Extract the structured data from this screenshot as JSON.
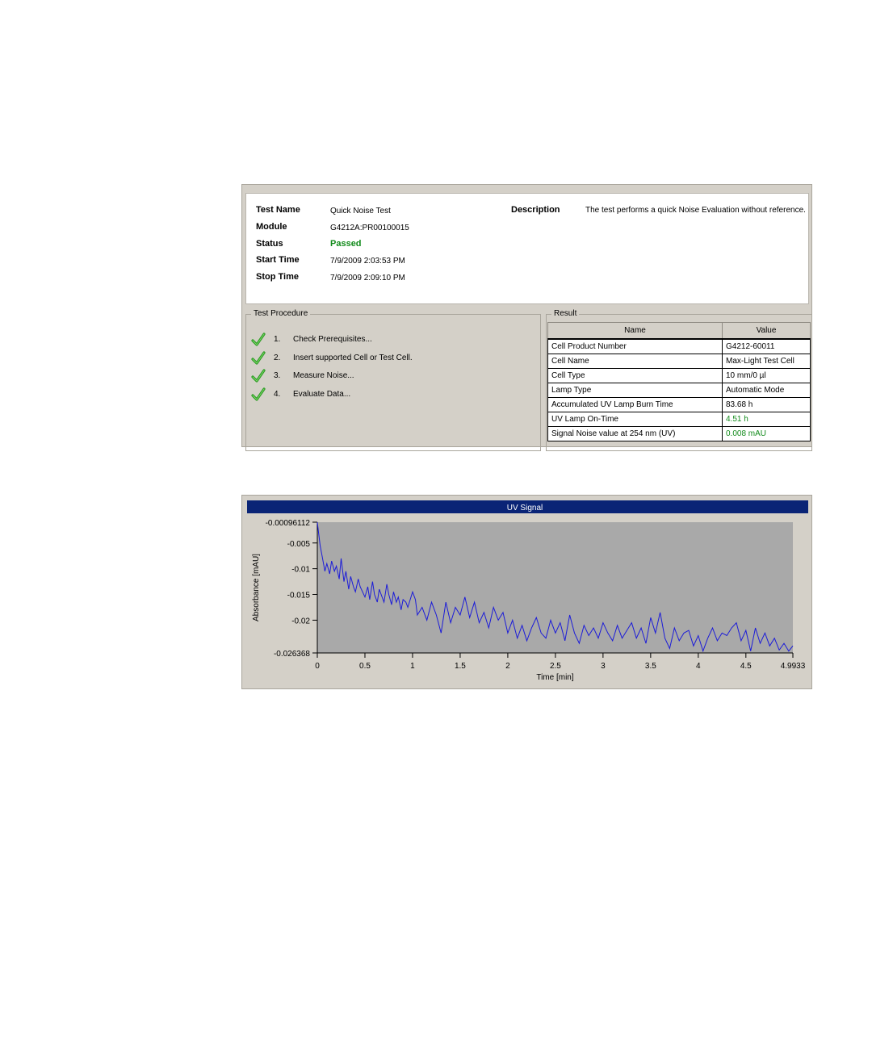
{
  "header": {
    "labels": {
      "test_name": "Test Name",
      "module": "Module",
      "status": "Status",
      "start_time": "Start Time",
      "stop_time": "Stop Time",
      "description": "Description"
    },
    "test_name": "Quick Noise Test",
    "module": "G4212A:PR00100015",
    "status": "Passed",
    "start_time": "7/9/2009 2:03:53 PM",
    "stop_time": "7/9/2009 2:09:10 PM",
    "description": "The test performs a quick Noise Evaluation without reference."
  },
  "procedure": {
    "title": "Test Procedure",
    "steps": [
      {
        "num": "1.",
        "label": "Check Prerequisites...",
        "icon": "check-icon"
      },
      {
        "num": "2.",
        "label": "Insert supported Cell or Test Cell.",
        "icon": "check-icon"
      },
      {
        "num": "3.",
        "label": "Measure Noise...",
        "icon": "check-icon"
      },
      {
        "num": "4.",
        "label": "Evaluate Data...",
        "icon": "check-icon"
      }
    ]
  },
  "result": {
    "title": "Result",
    "columns": [
      "Name",
      "Value"
    ],
    "rows": [
      {
        "name": "Cell Product Number",
        "value": "G4212-60011"
      },
      {
        "name": "Cell Name",
        "value": "Max-Light Test Cell"
      },
      {
        "name": "Cell Type",
        "value": "10 mm/0 µl"
      },
      {
        "name": "Lamp Type",
        "value": "Automatic Mode"
      },
      {
        "name": "Accumulated UV Lamp Burn Time",
        "value": "83.68 h"
      },
      {
        "name": "UV Lamp On-Time",
        "value": "4.51 h"
      },
      {
        "name": "Signal Noise value at 254 nm (UV)",
        "value": "0.008 mAU"
      }
    ]
  },
  "colors": {
    "status_passed": "#118a1a",
    "chart_title_bar": "#0a2476",
    "plot_area": "#a9a9a9",
    "trace": "#1c1cd8"
  },
  "chart_data": {
    "type": "line",
    "title": "UV Signal",
    "xlabel": "Time [min]",
    "ylabel": "Absorbance [mAU]",
    "xlim": [
      0,
      4.9933
    ],
    "ylim": [
      -0.026368,
      -0.00096112
    ],
    "xticks": [
      0,
      0.5,
      1,
      1.5,
      2,
      2.5,
      3,
      3.5,
      4,
      4.5,
      4.9933
    ],
    "xtick_labels": [
      "0",
      "0.5",
      "1",
      "1.5",
      "2",
      "2.5",
      "3",
      "3.5",
      "4",
      "4.5",
      "4.9933"
    ],
    "yticks": [
      -0.00096112,
      -0.005,
      -0.01,
      -0.015,
      -0.02,
      -0.026368
    ],
    "ytick_labels": [
      "-0.00096112",
      "-0.005",
      "-0.01",
      "-0.015",
      "-0.02",
      "-0.026368"
    ],
    "grid": false,
    "x": [
      0,
      0.03,
      0.05,
      0.08,
      0.1,
      0.13,
      0.15,
      0.18,
      0.2,
      0.23,
      0.25,
      0.28,
      0.3,
      0.33,
      0.35,
      0.38,
      0.4,
      0.43,
      0.45,
      0.5,
      0.53,
      0.55,
      0.58,
      0.6,
      0.63,
      0.65,
      0.68,
      0.7,
      0.73,
      0.75,
      0.78,
      0.8,
      0.83,
      0.85,
      0.88,
      0.9,
      0.93,
      0.95,
      1.0,
      1.03,
      1.05,
      1.1,
      1.15,
      1.2,
      1.25,
      1.3,
      1.35,
      1.4,
      1.45,
      1.5,
      1.55,
      1.6,
      1.65,
      1.7,
      1.75,
      1.8,
      1.85,
      1.9,
      1.95,
      2.0,
      2.05,
      2.1,
      2.15,
      2.2,
      2.25,
      2.3,
      2.35,
      2.4,
      2.45,
      2.5,
      2.55,
      2.6,
      2.65,
      2.7,
      2.75,
      2.8,
      2.85,
      2.9,
      2.95,
      3.0,
      3.05,
      3.1,
      3.15,
      3.2,
      3.25,
      3.3,
      3.35,
      3.4,
      3.45,
      3.5,
      3.55,
      3.6,
      3.65,
      3.7,
      3.75,
      3.8,
      3.85,
      3.9,
      3.95,
      4.0,
      4.05,
      4.1,
      4.15,
      4.2,
      4.25,
      4.3,
      4.35,
      4.4,
      4.45,
      4.5,
      4.55,
      4.6,
      4.65,
      4.7,
      4.75,
      4.8,
      4.85,
      4.9,
      4.95,
      4.9933
    ],
    "values": [
      -0.001,
      -0.0055,
      -0.0075,
      -0.0105,
      -0.009,
      -0.011,
      -0.0085,
      -0.0105,
      -0.0095,
      -0.012,
      -0.008,
      -0.0125,
      -0.0105,
      -0.014,
      -0.0115,
      -0.0135,
      -0.0145,
      -0.012,
      -0.0135,
      -0.0155,
      -0.0135,
      -0.016,
      -0.0125,
      -0.015,
      -0.0165,
      -0.014,
      -0.0155,
      -0.0165,
      -0.013,
      -0.015,
      -0.017,
      -0.0145,
      -0.0165,
      -0.0155,
      -0.018,
      -0.016,
      -0.0165,
      -0.0175,
      -0.0145,
      -0.016,
      -0.019,
      -0.0175,
      -0.02,
      -0.0165,
      -0.019,
      -0.0225,
      -0.0165,
      -0.0205,
      -0.0175,
      -0.019,
      -0.0155,
      -0.0195,
      -0.0165,
      -0.0205,
      -0.0185,
      -0.0215,
      -0.0175,
      -0.02,
      -0.0185,
      -0.0225,
      -0.02,
      -0.0235,
      -0.021,
      -0.024,
      -0.0215,
      -0.0195,
      -0.0225,
      -0.0235,
      -0.02,
      -0.0225,
      -0.0205,
      -0.024,
      -0.019,
      -0.0225,
      -0.0245,
      -0.021,
      -0.023,
      -0.0215,
      -0.0235,
      -0.0205,
      -0.0225,
      -0.024,
      -0.021,
      -0.0235,
      -0.022,
      -0.0205,
      -0.0235,
      -0.0215,
      -0.0245,
      -0.0195,
      -0.0225,
      -0.0185,
      -0.0235,
      -0.0255,
      -0.0215,
      -0.024,
      -0.0225,
      -0.022,
      -0.025,
      -0.023,
      -0.026,
      -0.0235,
      -0.0215,
      -0.024,
      -0.0225,
      -0.023,
      -0.0215,
      -0.0205,
      -0.024,
      -0.022,
      -0.026,
      -0.0215,
      -0.0245,
      -0.0225,
      -0.025,
      -0.0235,
      -0.0258,
      -0.0245,
      -0.026,
      -0.025
    ]
  }
}
